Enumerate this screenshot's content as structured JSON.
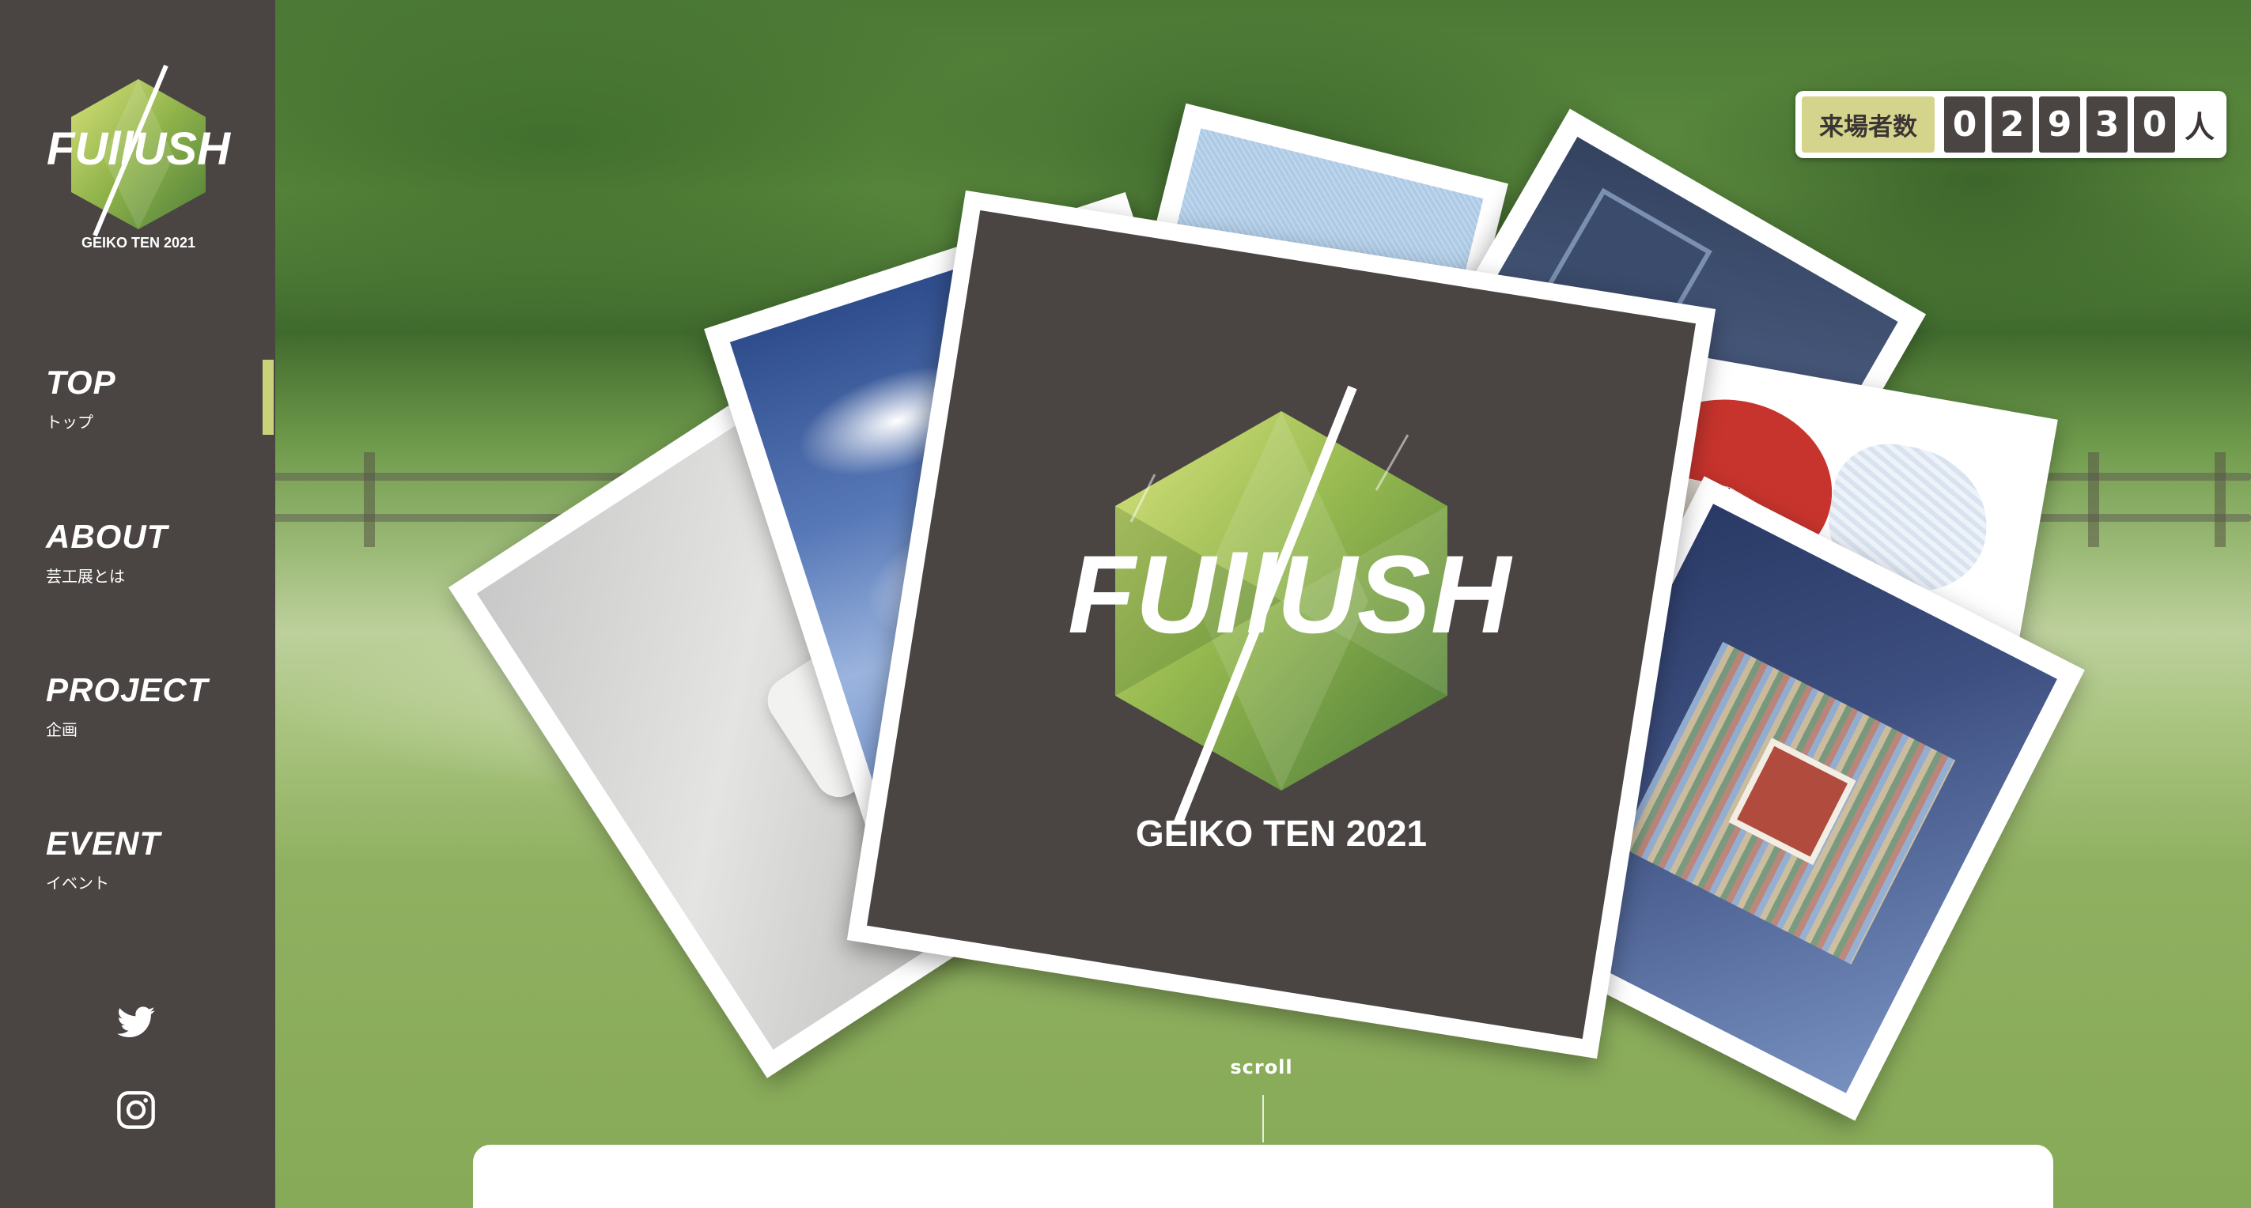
{
  "brand": {
    "logo_word": "FUllUSH",
    "logo_sub": "GEIKO TEN 2021",
    "accent": "#c9d27a",
    "sidebar_bg": "#4a4443"
  },
  "nav": {
    "items": [
      {
        "en": "TOP",
        "ja": "トップ",
        "active": true
      },
      {
        "en": "ABOUT",
        "ja": "芸工展とは"
      },
      {
        "en": "PROJECT",
        "ja": "企画"
      },
      {
        "en": "EVENT",
        "ja": "イベント"
      }
    ]
  },
  "social": {
    "twitter_icon": "twitter-icon",
    "instagram_icon": "instagram-icon"
  },
  "counter": {
    "label": "来場者数",
    "digits": [
      "0",
      "2",
      "9",
      "3",
      "0"
    ],
    "unit": "人"
  },
  "hero": {
    "logo_word": "FUllUSH",
    "logo_sub": "GEIKO TEN 2021"
  },
  "scroll": {
    "label": "scroll"
  }
}
